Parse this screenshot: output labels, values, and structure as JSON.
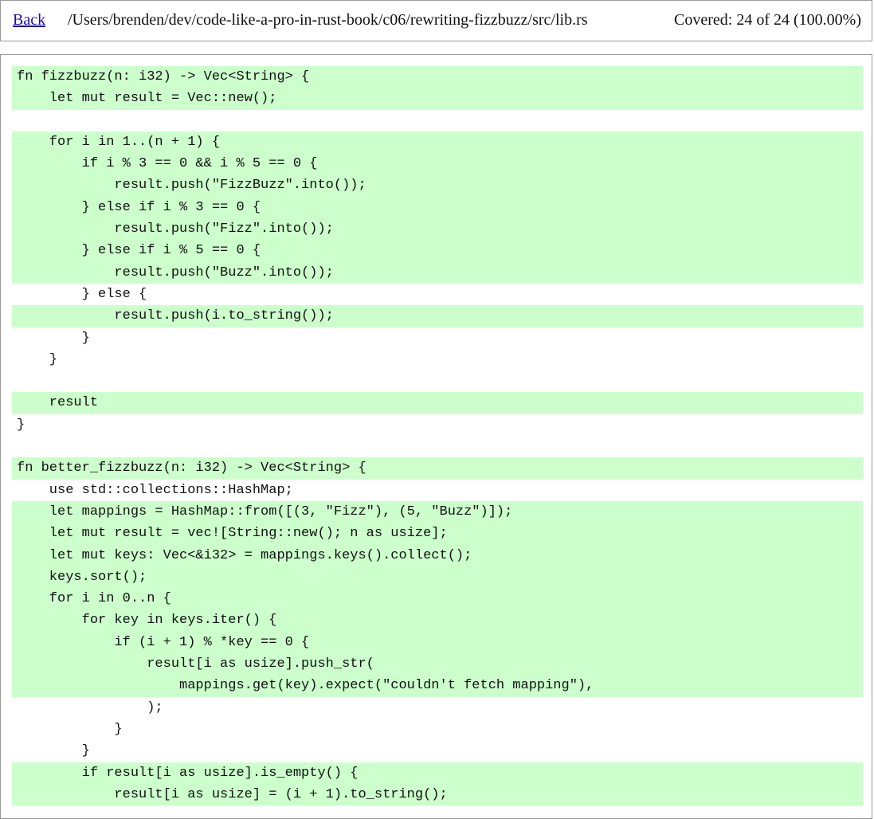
{
  "header": {
    "back_label": "Back",
    "file_path": "/Users/brenden/dev/code-like-a-pro-in-rust-book/c06/rewriting-fizzbuzz/src/lib.rs",
    "coverage": "Covered: 24 of 24 (100.00%)"
  },
  "colors": {
    "covered_background": "#ccffcc",
    "link": "#1a0dab",
    "border": "#9a9a9a"
  },
  "code_lines": [
    {
      "text": "fn fizzbuzz(n: i32) -> Vec<String> {",
      "covered": true
    },
    {
      "text": "    let mut result = Vec::new();",
      "covered": true
    },
    {
      "text": "",
      "covered": false
    },
    {
      "text": "    for i in 1..(n + 1) {",
      "covered": true
    },
    {
      "text": "        if i % 3 == 0 && i % 5 == 0 {",
      "covered": true
    },
    {
      "text": "            result.push(\"FizzBuzz\".into());",
      "covered": true
    },
    {
      "text": "        } else if i % 3 == 0 {",
      "covered": true
    },
    {
      "text": "            result.push(\"Fizz\".into());",
      "covered": true
    },
    {
      "text": "        } else if i % 5 == 0 {",
      "covered": true
    },
    {
      "text": "            result.push(\"Buzz\".into());",
      "covered": true
    },
    {
      "text": "        } else {",
      "covered": false
    },
    {
      "text": "            result.push(i.to_string());",
      "covered": true
    },
    {
      "text": "        }",
      "covered": false
    },
    {
      "text": "    }",
      "covered": false
    },
    {
      "text": "",
      "covered": false
    },
    {
      "text": "    result",
      "covered": true
    },
    {
      "text": "}",
      "covered": false
    },
    {
      "text": "",
      "covered": false
    },
    {
      "text": "fn better_fizzbuzz(n: i32) -> Vec<String> {",
      "covered": true
    },
    {
      "text": "    use std::collections::HashMap;",
      "covered": false
    },
    {
      "text": "    let mappings = HashMap::from([(3, \"Fizz\"), (5, \"Buzz\")]);",
      "covered": true
    },
    {
      "text": "    let mut result = vec![String::new(); n as usize];",
      "covered": true
    },
    {
      "text": "    let mut keys: Vec<&i32> = mappings.keys().collect();",
      "covered": true
    },
    {
      "text": "    keys.sort();",
      "covered": true
    },
    {
      "text": "    for i in 0..n {",
      "covered": true
    },
    {
      "text": "        for key in keys.iter() {",
      "covered": true
    },
    {
      "text": "            if (i + 1) % *key == 0 {",
      "covered": true
    },
    {
      "text": "                result[i as usize].push_str(",
      "covered": true
    },
    {
      "text": "                    mappings.get(key).expect(\"couldn't fetch mapping\"),",
      "covered": true
    },
    {
      "text": "                );",
      "covered": false
    },
    {
      "text": "            }",
      "covered": false
    },
    {
      "text": "        }",
      "covered": false
    },
    {
      "text": "        if result[i as usize].is_empty() {",
      "covered": true
    },
    {
      "text": "            result[i as usize] = (i + 1).to_string();",
      "covered": true
    }
  ]
}
